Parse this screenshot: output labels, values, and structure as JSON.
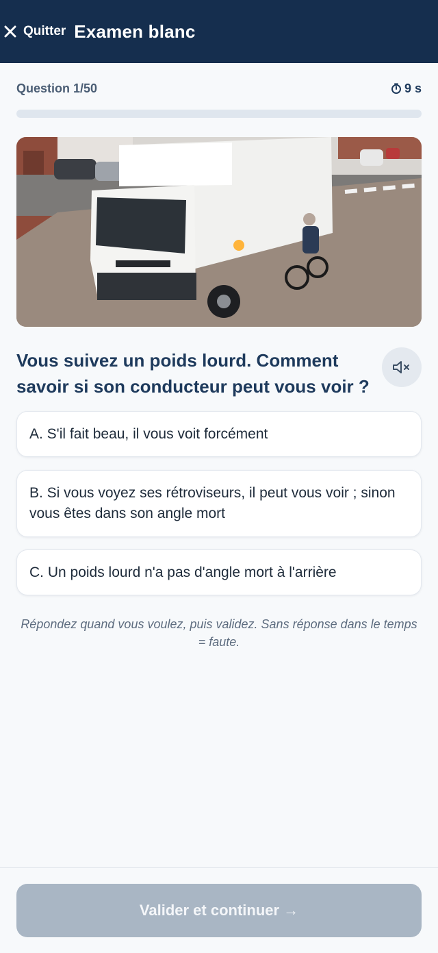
{
  "header": {
    "quit_label": "Quitter",
    "title": "Examen blanc"
  },
  "quiz": {
    "counter": "Question 1/50",
    "timer": "9 s",
    "progress_fraction": 0.0,
    "question": "Vous suivez un poids lourd. Comment savoir si son conducteur peut vous voir ?",
    "answers": [
      {
        "label": "A. S'il fait beau, il vous voit forcément"
      },
      {
        "label": "B. Si vous voyez ses rétroviseurs, il peut vous voir ; sinon vous êtes dans son angle mort"
      },
      {
        "label": "C. Un poids lourd n'a pas d'angle mort à l'arrière"
      }
    ],
    "hint": "Répondez quand vous voulez, puis validez. Sans réponse dans le temps = faute."
  },
  "footer": {
    "validate_label": "Valider et continuer",
    "validate_arrow": "→"
  },
  "colors": {
    "header_bg": "#152e4e",
    "accent": "#2a8fd6",
    "button_disabled": "#a9b6c4"
  }
}
